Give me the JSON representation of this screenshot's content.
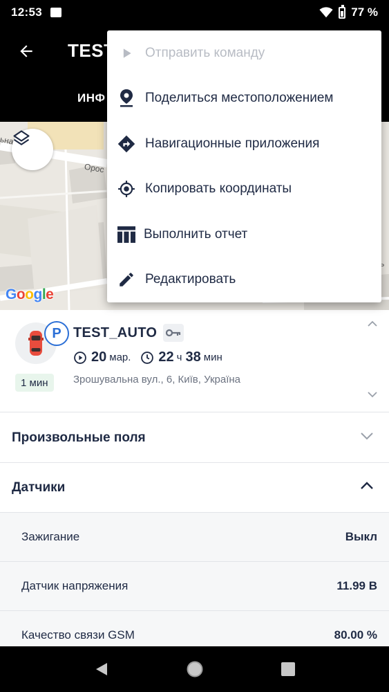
{
  "status_bar": {
    "time": "12:53",
    "battery": "77 %"
  },
  "app_bar": {
    "title": "TEST",
    "tab_info": "ИНФ"
  },
  "map": {
    "google_logo": "Google",
    "street_1": "Орос",
    "street_2": "ьна",
    "street_3": "ь"
  },
  "menu": {
    "items": [
      {
        "label": "Отправить команду",
        "icon": "play-icon",
        "disabled": true
      },
      {
        "label": "Поделиться местоположением",
        "icon": "location-pin-icon"
      },
      {
        "label": "Навигационные приложения",
        "icon": "directions-icon"
      },
      {
        "label": "Копировать координаты",
        "icon": "gps-target-icon"
      },
      {
        "label": "Выполнить отчет",
        "icon": "table-icon"
      },
      {
        "label": "Редактировать",
        "icon": "pencil-icon"
      }
    ]
  },
  "vehicle": {
    "name": "TEST_AUTO",
    "parking_letter": "P",
    "date_day": "20",
    "date_month": "мар.",
    "duration_hours": "22",
    "hours_unit": "ч",
    "duration_minutes": "38",
    "minutes_unit": "мин",
    "age": "1 мин",
    "address": "Зрошувальна вул., 6, Київ, Україна"
  },
  "sections": {
    "custom_fields": "Произвольные поля",
    "sensors": "Датчики"
  },
  "sensors": [
    {
      "label": "Зажигание",
      "value": "Выкл"
    },
    {
      "label": "Датчик напряжения",
      "value": "11.99 В"
    },
    {
      "label": "Качество связи GSM",
      "value": "80.00 %"
    }
  ],
  "colors": {
    "accent": "#2b6fd6",
    "text": "#1f2a44",
    "disabled": "#b8bcc4"
  }
}
